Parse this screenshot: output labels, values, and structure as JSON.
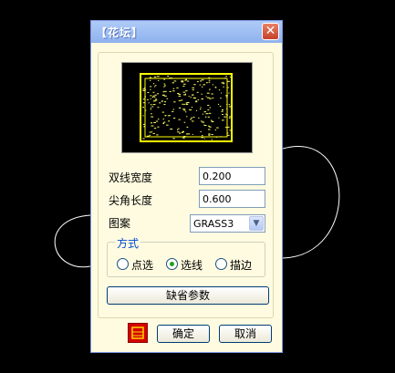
{
  "dialog": {
    "title": "【花坛】",
    "close_symbol": "✕",
    "fields": [
      {
        "label": "双线宽度",
        "value": "0.200"
      },
      {
        "label": "尖角长度",
        "value": "0.600"
      }
    ],
    "pattern": {
      "label": "图案",
      "selected": "GRASS3"
    },
    "mode": {
      "label": "方式",
      "options": [
        {
          "label": "点选",
          "selected": false
        },
        {
          "label": "选线",
          "selected": true
        },
        {
          "label": "描边",
          "selected": false
        }
      ]
    },
    "default_params_label": "缺省参数",
    "ok_label": "确定",
    "cancel_label": "取消"
  }
}
